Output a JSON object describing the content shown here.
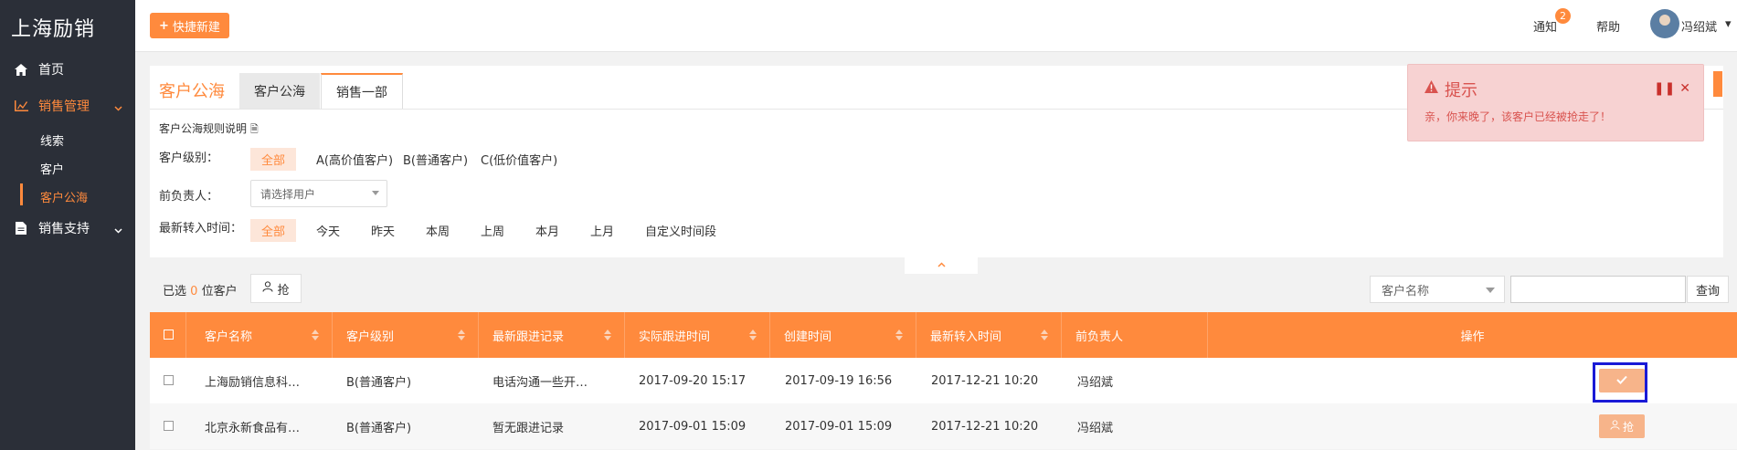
{
  "sidebar": {
    "brand": "上海励销",
    "items": [
      {
        "label": "首页",
        "icon": "home-icon"
      },
      {
        "label": "销售管理",
        "icon": "chart-icon"
      },
      {
        "label": "销售支持",
        "icon": "document-icon"
      }
    ],
    "sub_items": [
      "线索",
      "客户",
      "客户公海"
    ]
  },
  "topbar": {
    "quick_new": "快捷新建",
    "notify": "通知",
    "notify_count": "2",
    "help": "帮助",
    "user": "冯绍斌"
  },
  "panel": {
    "title": "客户公海",
    "tabs": [
      "客户公海",
      "销售一部"
    ],
    "rules": "客户公海规则说明",
    "filters": {
      "level_label": "客户级别：",
      "levels": [
        "全部",
        "A(高价值客户)",
        "B(普通客户)",
        "C(低价值客户)"
      ],
      "owner_label": "前负责人：",
      "owner_placeholder": "请选择用户",
      "time_label": "最新转入时间：",
      "times": [
        "全部",
        "今天",
        "昨天",
        "本周",
        "上周",
        "本月",
        "上月",
        "自定义时间段"
      ]
    }
  },
  "list": {
    "selected_prefix": "已选",
    "selected_count": "0",
    "selected_suffix": "位客户",
    "grab": "抢",
    "search_field": "客户名称",
    "search_btn": "查询"
  },
  "table": {
    "headers": [
      "客户名称",
      "客户级别",
      "最新跟进记录",
      "实际跟进时间",
      "创建时间",
      "最新转入时间",
      "前负责人",
      "操作"
    ],
    "rows": [
      {
        "name": "上海励销信息科…",
        "level": "B(普通客户)",
        "record": "电话沟通一些开…",
        "follow": "2017-09-20 15:17",
        "created": "2017-09-19 16:56",
        "transfer": "2017-12-21 10:20",
        "owner": "冯绍斌"
      },
      {
        "name": "北京永新食品有…",
        "level": "B(普通客户)",
        "record": "暂无跟进记录",
        "follow": "2017-09-01 15:09",
        "created": "2017-09-01 15:09",
        "transfer": "2017-12-21 10:20",
        "owner": "冯绍斌",
        "action": "抢"
      }
    ]
  },
  "toast": {
    "title": "提示",
    "message": "亲，你来晚了，该客户已经被抢走了！"
  },
  "colors": {
    "accent": "#ff8a3d",
    "sidebar": "#2b2f38",
    "toast_bg": "#f7d2d2",
    "toast_text": "#d9534f"
  }
}
